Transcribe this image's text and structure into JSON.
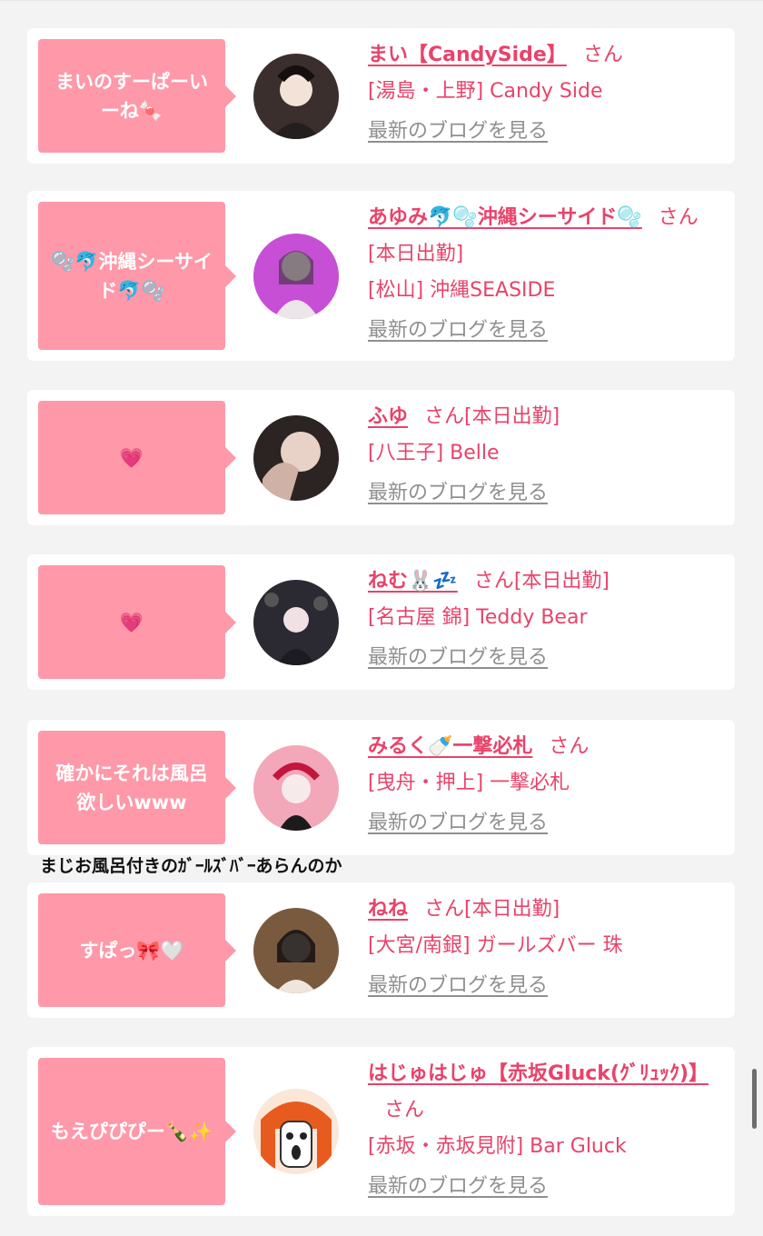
{
  "posts": [
    {
      "message": "まいのすーぱーいーね🍬",
      "name": "まい【CandySide】",
      "san": "さん",
      "status": "",
      "shop": "[湯島・上野] Candy Side",
      "blog": "最新のブログを見る",
      "avatar_color": "#5a4a44"
    },
    {
      "message": "🫧🐬沖縄シーサイド🐬🫧",
      "name": "あゆみ🐬🫧沖縄シーサイド🫧",
      "san": "さん",
      "status": "[本日出勤]",
      "shop": "[松山] 沖縄SEASIDE",
      "blog": "最新のブログを見る",
      "avatar_color": "#c64fd6"
    },
    {
      "message": "💗",
      "name": "ふゆ",
      "san": "さん",
      "status": "[本日出勤]",
      "shop": "[八王子] Belle",
      "blog": "最新のブログを見る",
      "avatar_color": "#8a7468"
    },
    {
      "message": "💗",
      "name": "ねむ🐰💤",
      "san": "さん",
      "status": "[本日出勤]",
      "shop": "[名古屋 錦] Teddy Bear",
      "blog": "最新のブログを見る",
      "avatar_color": "#3c3b47"
    },
    {
      "message": "確かにそれは風呂欲しいwww",
      "name": "みるく🍼一撃必札",
      "san": "さん",
      "status": "",
      "shop": "[曳舟・押上] 一撃必札",
      "blog": "最新のブログを見る",
      "avatar_color": "#e47b93"
    },
    {
      "message": "すぱっ🎀🤍",
      "name": "ねね",
      "san": "さん",
      "status": "[本日出勤]",
      "shop": "[大宮/南銀] ガールズバー 珠",
      "blog": "最新のブログを見る",
      "avatar_color": "#5a3f31"
    },
    {
      "message": "もえぴぴぴー🍾✨",
      "name": "はじゅはじゅ【赤坂Gluck(ｸﾞﾘｭｯｸ)】",
      "san": "さん",
      "status": "",
      "shop": "[赤坂・赤坂見附] Bar Gluck",
      "blog": "最新のブログを見る",
      "avatar_color": "#e85b1e"
    }
  ],
  "between_text": "まじお風呂付きのｶﾞｰﾙｽﾞﾊﾞｰあらんのか"
}
